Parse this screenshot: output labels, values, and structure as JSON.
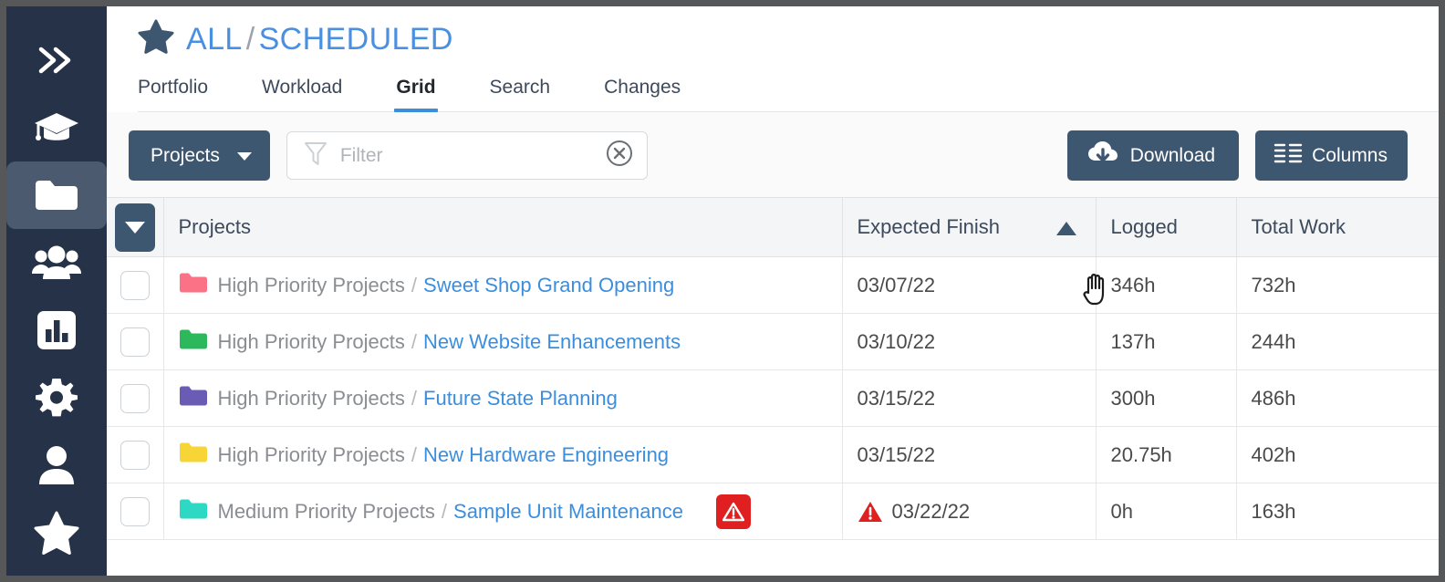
{
  "sidebar": {
    "items": [
      {
        "name": "expand",
        "icon": "double-chevron-right-icon",
        "active": false
      },
      {
        "name": "training",
        "icon": "graduation-cap-icon",
        "active": false
      },
      {
        "name": "projects",
        "icon": "folder-icon",
        "active": true
      },
      {
        "name": "people",
        "icon": "users-group-icon",
        "active": false
      },
      {
        "name": "reports",
        "icon": "bar-chart-icon",
        "active": false
      },
      {
        "name": "settings",
        "icon": "gear-icon",
        "active": false
      },
      {
        "name": "account",
        "icon": "person-icon",
        "active": false
      },
      {
        "name": "favorites",
        "icon": "star-icon",
        "active": false
      }
    ]
  },
  "header": {
    "star_icon": "star-icon",
    "breadcrumb_root": "ALL",
    "breadcrumb_separator": "/",
    "breadcrumb_current": "SCHEDULED"
  },
  "tabs": [
    {
      "label": "Portfolio",
      "active": false
    },
    {
      "label": "Workload",
      "active": false
    },
    {
      "label": "Grid",
      "active": true
    },
    {
      "label": "Search",
      "active": false
    },
    {
      "label": "Changes",
      "active": false
    }
  ],
  "toolbar": {
    "projects_dropdown_label": "Projects",
    "filter_placeholder": "Filter",
    "filter_value": "",
    "filter_icon": "funnel-icon",
    "filter_clear_icon": "circle-x-icon",
    "download_label": "Download",
    "download_icon": "cloud-download-icon",
    "columns_label": "Columns",
    "columns_icon": "columns-list-icon"
  },
  "table": {
    "columns": [
      {
        "key": "check",
        "label": ""
      },
      {
        "key": "name",
        "label": "Projects"
      },
      {
        "key": "finish",
        "label": "Expected Finish",
        "sort": "asc"
      },
      {
        "key": "logged",
        "label": "Logged"
      },
      {
        "key": "total",
        "label": "Total Work"
      }
    ],
    "rows": [
      {
        "checked": false,
        "folder_color": "#fb7185",
        "parent": "High Priority Projects",
        "separator": "/",
        "project": "Sweet Shop Grand Opening",
        "warning_badge": false,
        "date_warning": false,
        "finish": "03/07/22",
        "logged": "346h",
        "total": "732h"
      },
      {
        "checked": false,
        "folder_color": "#2eb85c",
        "parent": "High Priority Projects",
        "separator": "/",
        "project": "New Website Enhancements",
        "warning_badge": false,
        "date_warning": false,
        "finish": "03/10/22",
        "logged": "137h",
        "total": "244h"
      },
      {
        "checked": false,
        "folder_color": "#6a5cb5",
        "parent": "High Priority Projects",
        "separator": "/",
        "project": "Future State Planning",
        "warning_badge": false,
        "date_warning": false,
        "finish": "03/15/22",
        "logged": "300h",
        "total": "486h"
      },
      {
        "checked": false,
        "folder_color": "#f7d536",
        "parent": "High Priority Projects",
        "separator": "/",
        "project": "New Hardware Engineering",
        "warning_badge": false,
        "date_warning": false,
        "finish": "03/15/22",
        "logged": "20.75h",
        "total": "402h"
      },
      {
        "checked": false,
        "folder_color": "#2ed9c3",
        "parent": "Medium Priority Projects",
        "separator": "/",
        "project": "Sample Unit Maintenance",
        "warning_badge": true,
        "date_warning": true,
        "finish": "03/22/22",
        "logged": "0h",
        "total": "163h"
      }
    ]
  },
  "colors": {
    "sidebar_bg": "#263247",
    "accent_blue": "#3b8ede",
    "button_slate": "#3e5770",
    "warning_red": "#e02020"
  }
}
